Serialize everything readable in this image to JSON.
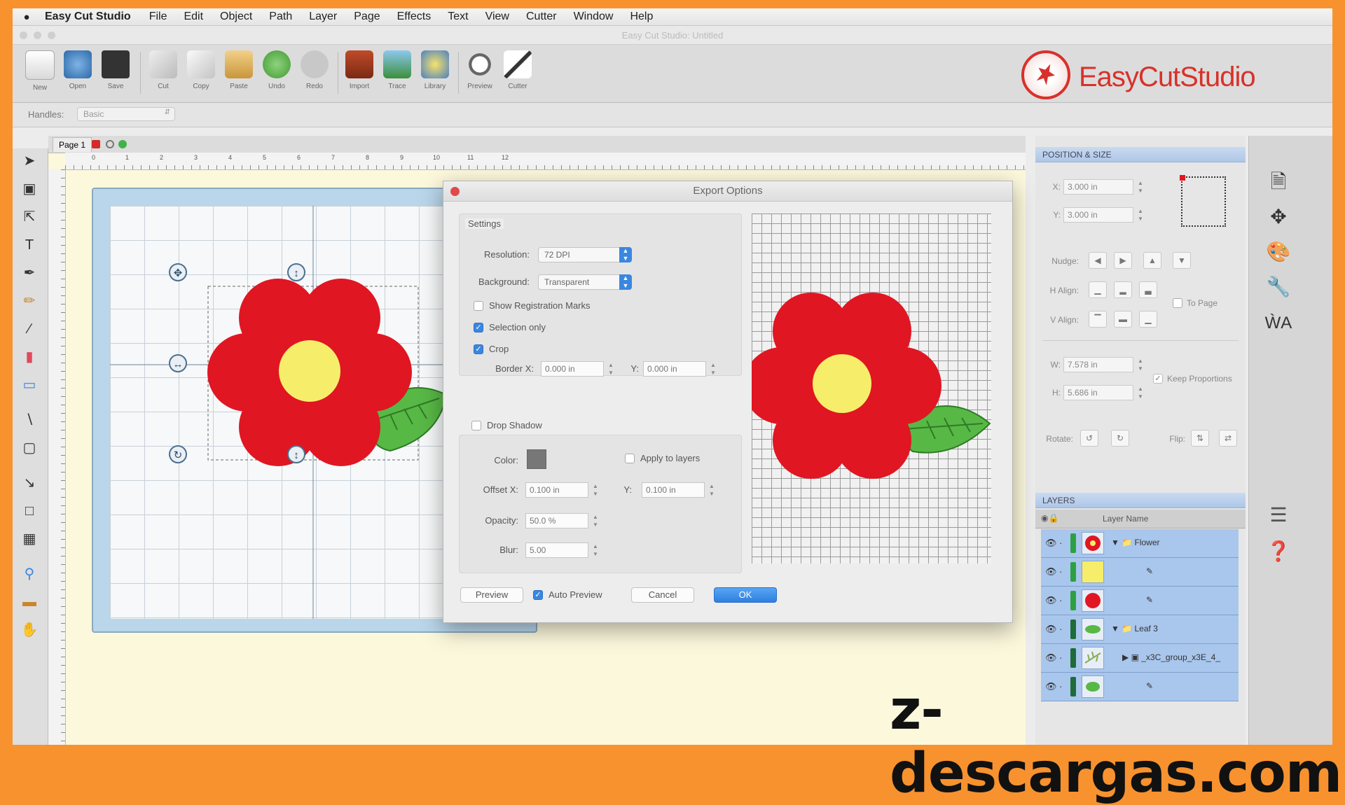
{
  "menubar": {
    "app_name": "Easy Cut Studio",
    "items": [
      "File",
      "Edit",
      "Object",
      "Path",
      "Layer",
      "Page",
      "Effects",
      "Text",
      "View",
      "Cutter",
      "Window",
      "Help"
    ]
  },
  "window": {
    "title": "Easy Cut Studio: Untitled"
  },
  "toolbar": {
    "buttons": [
      {
        "label": "New",
        "icon": "new-document-icon"
      },
      {
        "label": "Open",
        "icon": "open-icon"
      },
      {
        "label": "Save",
        "icon": "save-icon"
      },
      {
        "label": "Cut",
        "icon": "cut-icon"
      },
      {
        "label": "Copy",
        "icon": "copy-icon"
      },
      {
        "label": "Paste",
        "icon": "paste-icon"
      },
      {
        "label": "Undo",
        "icon": "undo-icon"
      },
      {
        "label": "Redo",
        "icon": "redo-icon"
      },
      {
        "label": "Import",
        "icon": "import-icon"
      },
      {
        "label": "Trace",
        "icon": "trace-icon"
      },
      {
        "label": "Library",
        "icon": "library-icon"
      },
      {
        "label": "Preview",
        "icon": "preview-icon"
      },
      {
        "label": "Cutter",
        "icon": "cutter-icon"
      }
    ],
    "logo_text": "EasyCutStudio"
  },
  "handles": {
    "label": "Handles:",
    "value": "Basic"
  },
  "page_tab": {
    "label": "Page 1"
  },
  "ruler": {
    "numbers": [
      "0",
      "1",
      "2",
      "3",
      "4",
      "5",
      "6",
      "7",
      "8",
      "9",
      "10",
      "11",
      "12"
    ]
  },
  "dialog": {
    "title": "Export Options",
    "settings_label": "Settings",
    "resolution_label": "Resolution:",
    "resolution_value": "72 DPI",
    "background_label": "Background:",
    "background_value": "Transparent",
    "show_reg_marks": "Show Registration Marks",
    "selection_only": "Selection only",
    "crop": "Crop",
    "border_x_label": "Border X:",
    "border_x_value": "0.000 in",
    "border_y_label": "Y:",
    "border_y_value": "0.000 in",
    "drop_shadow": "Drop Shadow",
    "color_label": "Color:",
    "apply_to_layers": "Apply to layers",
    "offset_x_label": "Offset X:",
    "offset_x_value": "0.100 in",
    "offset_y_label": "Y:",
    "offset_y_value": "0.100 in",
    "opacity_label": "Opacity:",
    "opacity_value": "50.0 %",
    "blur_label": "Blur:",
    "blur_value": "5.00",
    "preview_button": "Preview",
    "auto_preview": "Auto Preview",
    "cancel_button": "Cancel",
    "ok_button": "OK"
  },
  "position_size": {
    "header": "POSITION & SIZE",
    "x_label": "X:",
    "x_value": "3.000 in",
    "y_label": "Y:",
    "y_value": "3.000 in",
    "nudge_label": "Nudge:",
    "halign_label": "H Align:",
    "valign_label": "V Align:",
    "to_page": "To Page",
    "w_label": "W:",
    "w_value": "7.578 in",
    "h_label": "H:",
    "h_value": "5.686 in",
    "keep_proportions": "Keep Proportions",
    "rotate_label": "Rotate:",
    "flip_label": "Flip:"
  },
  "layers": {
    "header": "LAYERS",
    "column": "Layer Name",
    "rows": [
      {
        "name": "Flower",
        "bar_color": "#2ea043"
      },
      {
        "name": "",
        "bar_color": "#2ea043"
      },
      {
        "name": "",
        "bar_color": "#2ea043"
      },
      {
        "name": "Leaf 3",
        "bar_color": "#1f6b3a"
      },
      {
        "name": "_x3C_group_x3E_4_",
        "bar_color": "#1f6b3a"
      },
      {
        "name": "",
        "bar_color": "#1f6b3a"
      }
    ]
  },
  "colors": {
    "flower_red": "#e01622",
    "center_yellow": "#f6ee6a",
    "leaf_green": "#58b846",
    "accent_blue": "#3a87e0",
    "frame_orange": "#f7922f"
  },
  "watermark": "z-descargas.com"
}
